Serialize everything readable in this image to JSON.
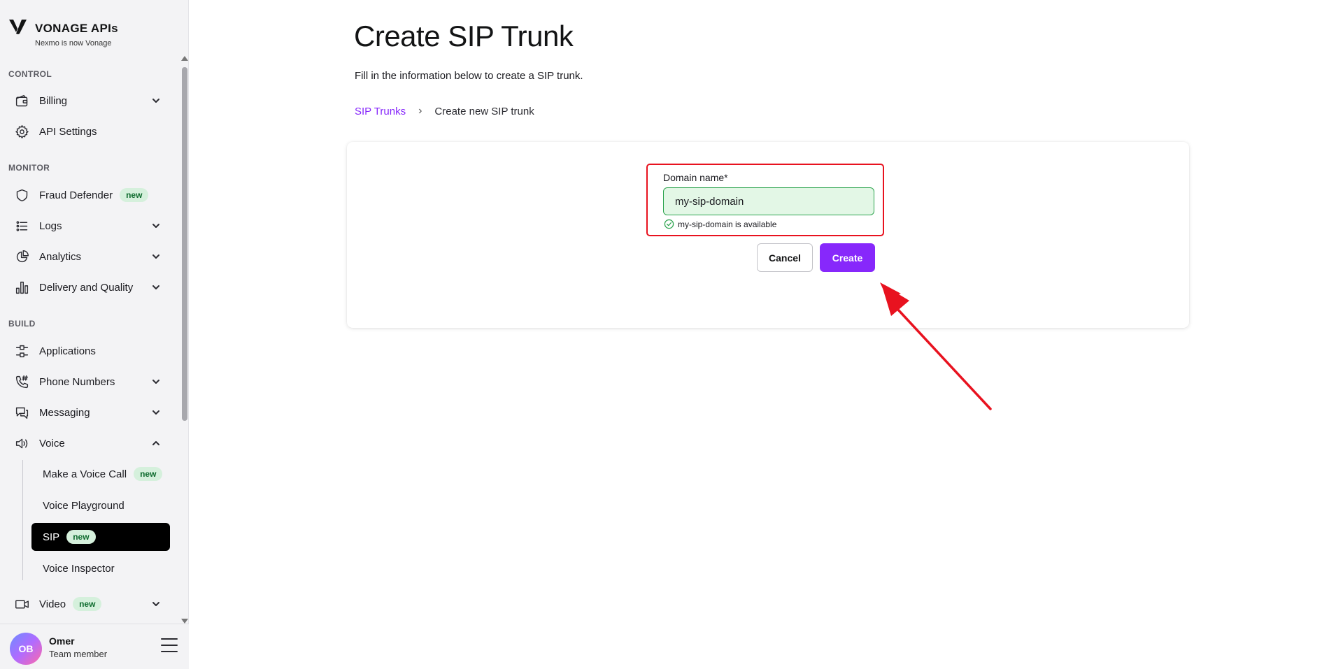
{
  "brand": {
    "title": "VONAGE APIs",
    "subtitle": "Nexmo is now Vonage"
  },
  "sidebar": {
    "sections": {
      "control": "CONTROL",
      "monitor": "MONITOR",
      "build": "BUILD"
    },
    "items": {
      "billing": "Billing",
      "api_settings": "API Settings",
      "fraud_defender": "Fraud Defender",
      "logs": "Logs",
      "analytics": "Analytics",
      "delivery_quality": "Delivery and Quality",
      "applications": "Applications",
      "phone_numbers": "Phone Numbers",
      "messaging": "Messaging",
      "voice": "Voice",
      "video": "Video"
    },
    "voice_sub": {
      "make_call": "Make a Voice Call",
      "playground": "Voice Playground",
      "sip": "SIP",
      "inspector": "Voice Inspector"
    },
    "badge_new": "new"
  },
  "user": {
    "initials": "OB",
    "name": "Omer",
    "role": "Team member"
  },
  "main": {
    "title": "Create SIP Trunk",
    "description": "Fill in the information below to create a SIP trunk.",
    "breadcrumb": {
      "link": "SIP Trunks",
      "separator": "›",
      "current": "Create new SIP trunk"
    },
    "form": {
      "label": "Domain name*",
      "value": "my-sip-domain",
      "help": "my-sip-domain is available",
      "cancel": "Cancel",
      "create": "Create"
    }
  },
  "colors": {
    "accent": "#8728fb",
    "success": "#2ea44f",
    "annotation": "#e8121f",
    "badge_bg": "#d5f0dc"
  }
}
